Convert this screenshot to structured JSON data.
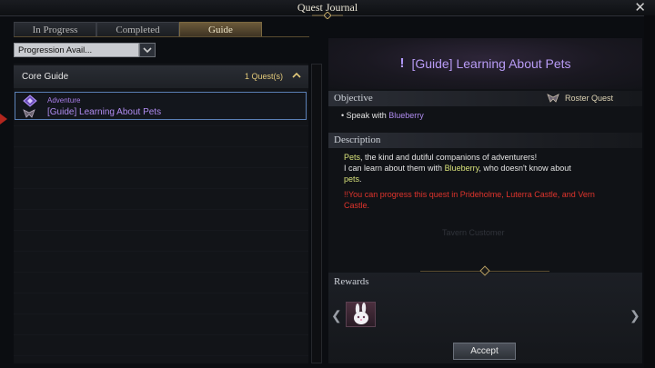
{
  "window": {
    "title": "Quest Journal",
    "close_icon": "close-icon"
  },
  "tabs": [
    {
      "label": "In Progress",
      "active": false
    },
    {
      "label": "Completed",
      "active": false
    },
    {
      "label": "Guide",
      "active": true
    }
  ],
  "filter": {
    "value": "Progression Avail...",
    "arrow_icon": "chevron-down-icon"
  },
  "list": {
    "category": {
      "name": "Core Guide",
      "count": "1 Quest(s)",
      "collapse_icon": "chevron-up-icon"
    },
    "quest": {
      "type": "Adventure",
      "name": "[Guide] Learning About Pets",
      "icon": "guide-gem-icon",
      "roster_icon": "roster-icon"
    }
  },
  "detail": {
    "title": "[Guide] Learning About Pets",
    "title_icon": "exclamation-icon",
    "objective_label": "Objective",
    "roster_label": "Roster Quest",
    "objective": {
      "bullet": "•",
      "prefix": "Speak with ",
      "npc": "Blueberry"
    },
    "description_label": "Description",
    "description": {
      "line1_highlight": "Pets",
      "line1_rest": ", the kind and dutiful companions of adventurers!",
      "line2_prefix": "I can learn about them with ",
      "line2_npc": "Blueberry",
      "line2_rest": ", who doesn't know about",
      "line3_highlight": "pets",
      "line3_rest": "."
    },
    "warning": "!!You can progress this quest in Prideholme, Luterra Castle, and Vern Castle.",
    "background_text": "Tavern Customer"
  },
  "rewards": {
    "label": "Rewards",
    "item_icon": "pet-bunny-icon",
    "prev_icon": "chevron-left-icon",
    "next_icon": "chevron-right-icon"
  },
  "accept_label": "Accept",
  "colors": {
    "accent_gold": "#e2c97a",
    "quest_purple": "#b08cf0",
    "npc_yellow": "#d9e37a",
    "warning_red": "#e0342c"
  }
}
